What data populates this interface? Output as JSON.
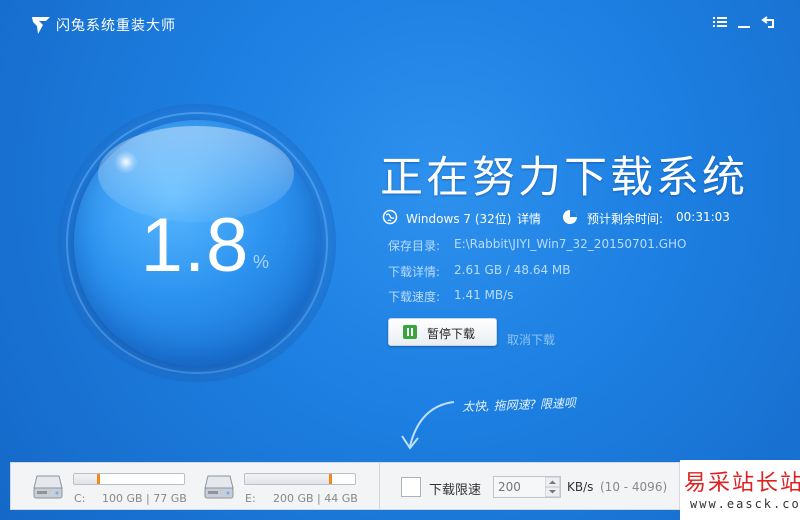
{
  "app": {
    "title": "闪兔系统重装大师"
  },
  "colors": {
    "accent": "#1d80e2",
    "marker": "#f08a1c",
    "pause_green": "#3aa43d"
  },
  "icons": {
    "logo": "rabbit-logo-icon",
    "menu": "menu-icon",
    "minimize": "minimize-icon",
    "back": "back-icon",
    "globe": "globe-icon",
    "clock": "clock-icon",
    "pause": "pause-icon",
    "drive": "hard-drive-icon"
  },
  "progress": {
    "value": "1.8",
    "unit": "%"
  },
  "status": {
    "headline": "正在努力下载系统",
    "os": "Windows 7 (32位)",
    "details_link": "详情",
    "eta_label": "预计剩余时间:",
    "eta_value": "00:31:03",
    "save_dir_label": "保存目录:",
    "save_dir_value": "E:\\Rabbit\\JIYI_Win7_32_20150701.GHO",
    "download_detail_label": "下载详情:",
    "download_detail_value": "2.61 GB / 48.64 MB",
    "speed_label": "下载速度:",
    "speed_value": "1.41 MB/s"
  },
  "actions": {
    "pause_label": "暂停下载",
    "cancel_label": "取消下载"
  },
  "hint": {
    "text": "太快, 拖网速? 限速呗"
  },
  "drives": [
    {
      "letter": "C:",
      "size": "100 GB | 77 GB",
      "used_fraction": 0.23
    },
    {
      "letter": "E:",
      "size": "200 GB | 44 GB",
      "used_fraction": 0.78
    }
  ],
  "limit": {
    "label": "下载限速",
    "checked": false,
    "value": "200",
    "unit": "KB/s",
    "range": "(10 - 4096)"
  },
  "watermark": {
    "top": "易采站长站",
    "bottom": "www.easck.com"
  }
}
